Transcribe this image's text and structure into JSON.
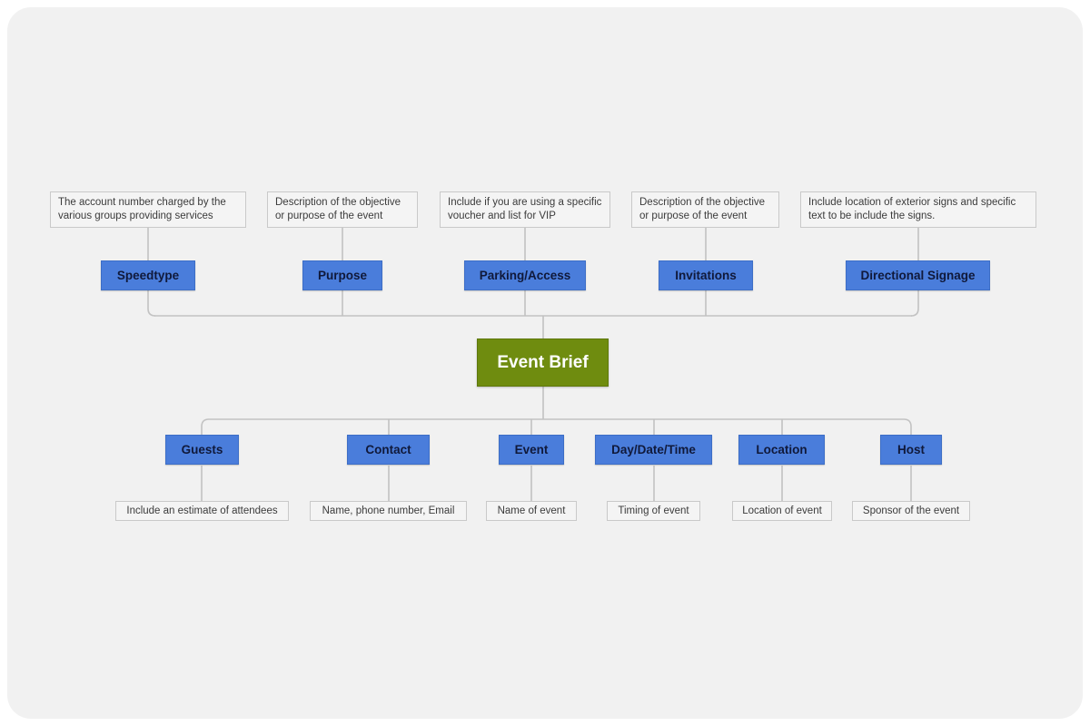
{
  "diagram": {
    "type": "mind-map",
    "title": "Event Brief",
    "root": {
      "label": "Event Brief",
      "color": "#6f8c0f",
      "text_color": "#ffffff"
    },
    "node_color": "#4a7ddb",
    "node_text_color": "#10193a",
    "caption_color": "#f4f4f4",
    "background": "#f1f1f1",
    "top_branches": [
      {
        "label": "Speedtype",
        "caption": "The account number charged by the various groups providing services"
      },
      {
        "label": "Purpose",
        "caption": "Description of the objective or purpose of the event"
      },
      {
        "label": "Parking/Access",
        "caption": "Include if you are using a specific voucher and list for VIP"
      },
      {
        "label": "Invitations",
        "caption": "Description of the objective or purpose of the event"
      },
      {
        "label": "Directional Signage",
        "caption": "Include location of exterior signs and specific text to be include the signs."
      }
    ],
    "bottom_branches": [
      {
        "label": "Guests",
        "caption": "Include an estimate of attendees"
      },
      {
        "label": "Contact",
        "caption": "Name, phone number, Email"
      },
      {
        "label": "Event",
        "caption": "Name of event"
      },
      {
        "label": "Day/Date/Time",
        "caption": "Timing of event"
      },
      {
        "label": "Location",
        "caption": "Location of event"
      },
      {
        "label": "Host",
        "caption": "Sponsor of the event"
      }
    ]
  }
}
